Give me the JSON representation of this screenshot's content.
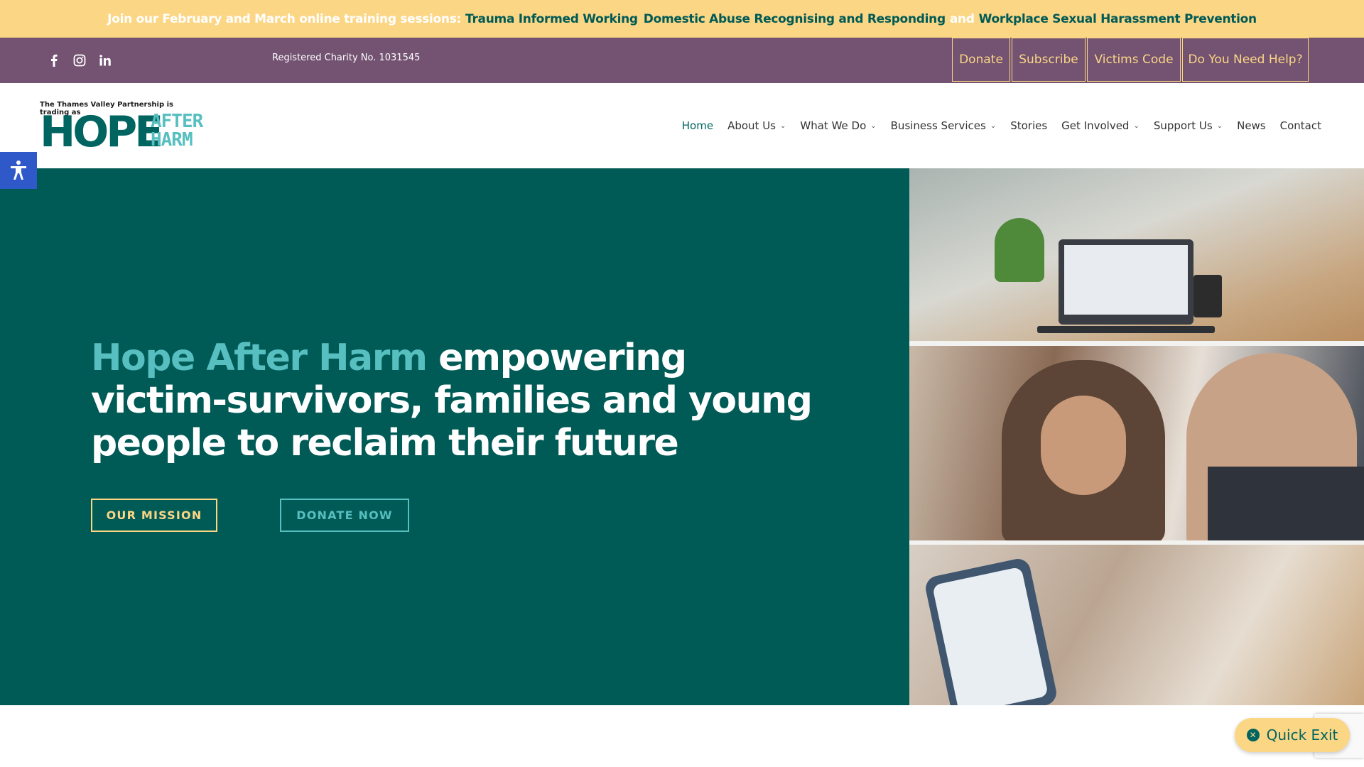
{
  "announcement": {
    "prefix": "Join our February and March online training sessions:",
    "links": [
      "Trauma Informed Working",
      "Domestic Abuse Recognising and Responding",
      "Workplace Sexual Harassment Prevention"
    ],
    "joiner": "and"
  },
  "topbar": {
    "charity_number": "Registered Charity No. 1031545",
    "social_icons": [
      "facebook-icon",
      "instagram-icon",
      "linkedin-icon"
    ],
    "buttons": [
      "Donate",
      "Subscribe",
      "Victims Code",
      "Do You Need Help?"
    ]
  },
  "logo": {
    "tagline": "The Thames Valley Partnership is trading as",
    "main": "HOPE",
    "after": "AFTER",
    "harm": "HARM"
  },
  "nav": {
    "items": [
      {
        "label": "Home",
        "dropdown": false,
        "active": true
      },
      {
        "label": "About Us",
        "dropdown": true
      },
      {
        "label": "What We Do",
        "dropdown": true
      },
      {
        "label": "Business Services",
        "dropdown": true
      },
      {
        "label": "Stories",
        "dropdown": false
      },
      {
        "label": "Get Involved",
        "dropdown": true
      },
      {
        "label": "Support Us",
        "dropdown": true
      },
      {
        "label": "News",
        "dropdown": false
      },
      {
        "label": "Contact",
        "dropdown": false
      }
    ]
  },
  "hero": {
    "headline_accent": "Hope After Harm",
    "headline_rest": "empowering victim-survivors, families and young people to reclaim their future",
    "primary_button": "OUR MISSION",
    "secondary_button": "DONATE NOW"
  },
  "quick_exit": {
    "label": "Quick Exit"
  },
  "colors": {
    "brand_teal": "#005a55",
    "accent_teal": "#57bfc0",
    "yellow": "#fbd685",
    "purple": "#735272"
  }
}
